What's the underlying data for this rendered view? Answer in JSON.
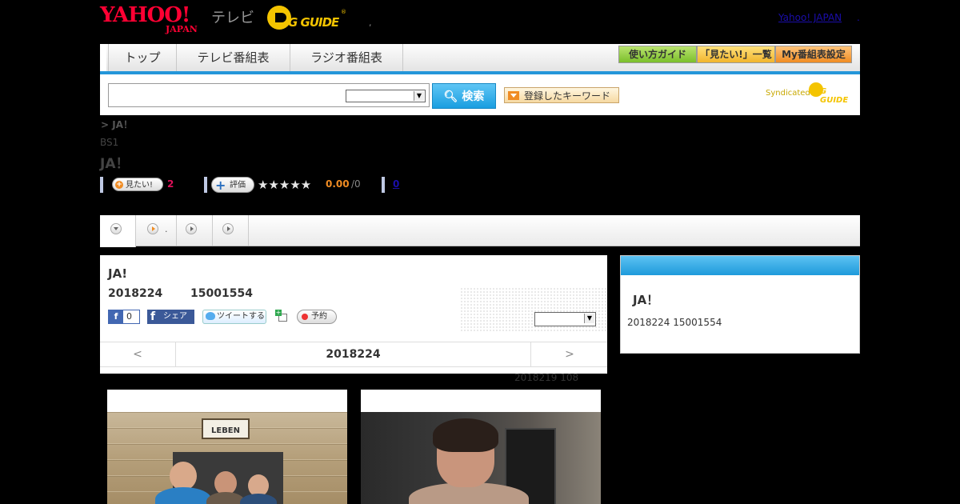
{
  "header": {
    "yahoo_logo_main": "YAHOO!",
    "yahoo_logo_sub": "JAPAN",
    "tv_label": "テレビ",
    "gguide_logo": "G GUIDE",
    "header_dot": ",",
    "yahoo_japan_link": "Yahoo! JAPAN",
    "yahoo_japan_dot": "."
  },
  "nav": {
    "tabs": [
      {
        "label": "トップ"
      },
      {
        "label": "テレビ番組表"
      },
      {
        "label": "ラジオ番組表"
      }
    ],
    "guide_button": "使い方ガイド",
    "mitai_list_button": "「見たい!」一覧",
    "my_schedule_button": "My番組表設定"
  },
  "search": {
    "input_value": "",
    "select_value": "",
    "search_button": "検索",
    "keyword_button": "登録したキーワード",
    "syndicated_label": "Syndicated",
    "syndicated_logo": "G GUIDE"
  },
  "program": {
    "breadcrumb": "> JA！",
    "channel": "BS1",
    "title": "JA！",
    "mitai_button": "見たい!",
    "mitai_count": "2",
    "hyoka_button": "評価",
    "stars": "★★★★★",
    "score": "0.00",
    "score_count": "/0",
    "review_link": "0"
  },
  "tabs": {
    "tab2_label": "."
  },
  "main_panel": {
    "title": "JA!",
    "date": "2018224",
    "time": "15001554",
    "fb_like_count": "0",
    "fb_share": "シェア",
    "tweet": "ツイートする",
    "reserve": "予約",
    "select_value": "",
    "pager_prev": "<",
    "pager_date": "2018224",
    "pager_next": ">",
    "updated": "2018219  108"
  },
  "side_panel": {
    "title": "JA！",
    "time": "2018224  15001554"
  },
  "photos": {
    "sign_text": "LEBEN"
  },
  "colors": {
    "nav_accent": "#2496d9",
    "search_button": "#1a9ee0",
    "yahoo_red": "#ff0033",
    "gguide_yellow": "#f4c400",
    "mitai_count": "#e0115a",
    "score": "#f08c23"
  }
}
